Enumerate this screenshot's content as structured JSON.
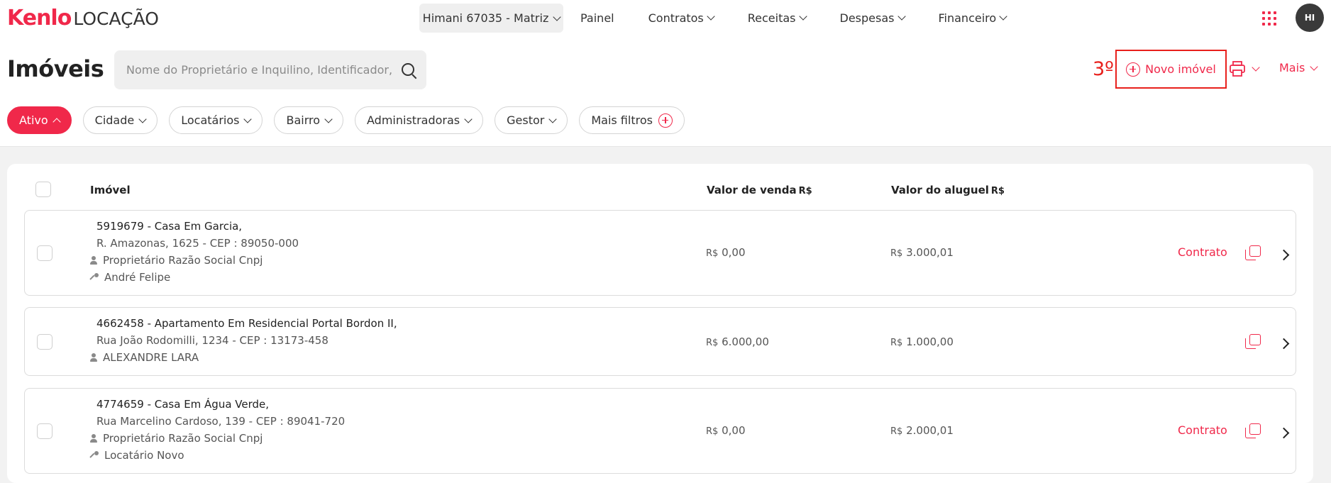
{
  "header": {
    "brand": "Kenlo",
    "product": "LOCAÇÃO",
    "branch": "Himani 67035 - Matriz",
    "nav": [
      "Painel",
      "Contratos",
      "Receitas",
      "Despesas",
      "Financeiro"
    ],
    "avatar_initials": "HI",
    "apps_icon": "grid-dots-icon"
  },
  "page": {
    "title": "Imóveis",
    "search_placeholder": "Nome do Proprietário e Inquilino, Identificador, P",
    "annotation": "3º",
    "new_button": "Novo imóvel",
    "more_label": "Mais"
  },
  "filters": [
    "Ativo",
    "Cidade",
    "Locatários",
    "Bairro",
    "Administradoras",
    "Gestor",
    "Mais filtros"
  ],
  "table": {
    "headers": {
      "property": "Imóvel",
      "sale_value": "Valor de venda",
      "rent_value": "Valor do aluguel",
      "currency": "R$"
    },
    "rows": [
      {
        "title": "5919679 - Casa Em Garcia,",
        "address": "R. Amazonas, 1625 - CEP : 89050-000",
        "owner": "Proprietário Razão Social Cnpj",
        "tenant": "André Felipe",
        "sale_currency": "R$",
        "sale": "0,00",
        "rent_currency": "R$",
        "rent": "3.000,01",
        "contract": "Contrato"
      },
      {
        "title": "4662458 - Apartamento Em Residencial Portal Bordon II,",
        "address": "Rua João Rodomilli, 1234 - CEP : 13173-458",
        "owner": "ALEXANDRE LARA",
        "tenant": "",
        "sale_currency": "R$",
        "sale": "6.000,00",
        "rent_currency": "R$",
        "rent": "1.000,00",
        "contract": ""
      },
      {
        "title": "4774659 - Casa Em Água Verde,",
        "address": "Rua Marcelino Cardoso, 139 - CEP : 89041-720",
        "owner": "Proprietário Razão Social Cnpj",
        "tenant": "Locatário Novo",
        "sale_currency": "R$",
        "sale": "0,00",
        "rent_currency": "R$",
        "rent": "2.000,01",
        "contract": "Contrato"
      }
    ]
  },
  "colors": {
    "accent": "#f0284a",
    "annotation": "#e8201c"
  }
}
